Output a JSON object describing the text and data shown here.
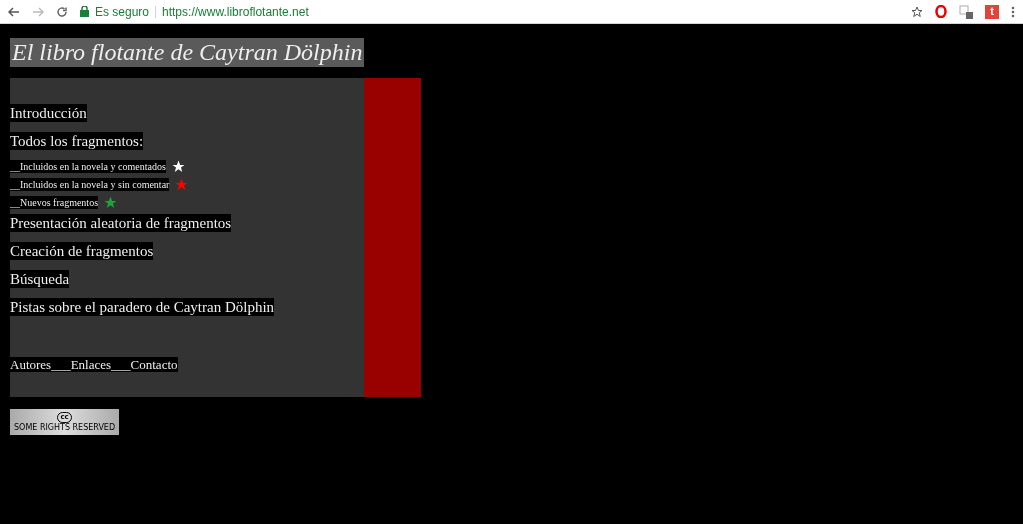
{
  "browser": {
    "secure_label": "Es seguro",
    "url": "https://www.libroflotante.net",
    "extension_badge": "t"
  },
  "site_title": "El libro flotante de Caytran Dölphin",
  "menu": [
    {
      "kind": "link",
      "label": "Introducción"
    },
    {
      "kind": "link",
      "label": "Todos los fragmentos:"
    },
    {
      "kind": "sub",
      "label": "__Incluidos en la novela y comentados",
      "color": "#ffffff"
    },
    {
      "kind": "sub",
      "label": "__Incluidos en la novela y sin comentar",
      "color": "#ff0000"
    },
    {
      "kind": "sub",
      "label": "__Nuevos fragmentos",
      "color": "#1fa33a"
    },
    {
      "kind": "link",
      "label": "Presentación aleatoria de fragmentos"
    },
    {
      "kind": "link",
      "label": "Creación de fragmentos"
    },
    {
      "kind": "link",
      "label": "Búsqueda"
    },
    {
      "kind": "link",
      "label": "Pistas sobre el paradero de Caytran Dölphin"
    }
  ],
  "footer_links": "Autores___Enlaces___Contacto",
  "license_badge": {
    "symbol": "cc",
    "text": "SOME RIGHTS RESERVED"
  }
}
